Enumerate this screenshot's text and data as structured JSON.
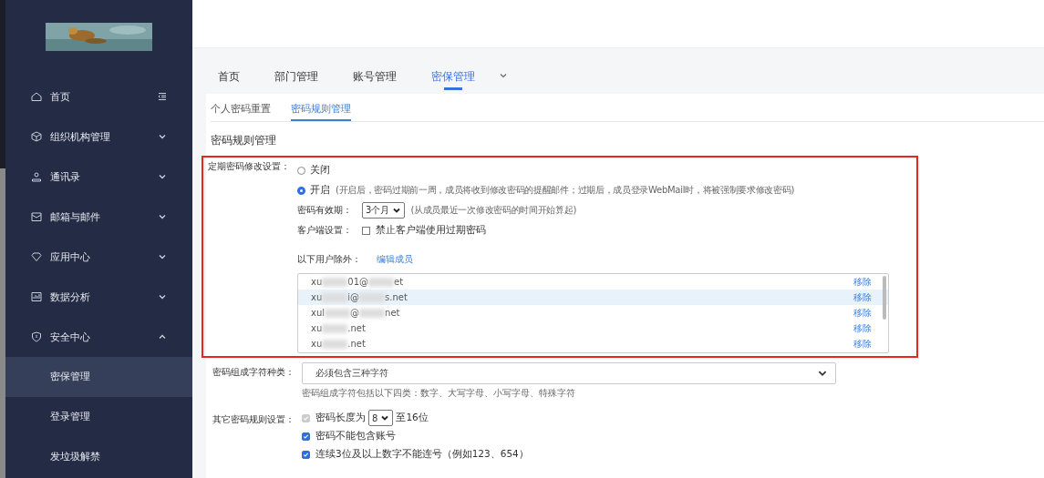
{
  "sidebar": {
    "items": [
      {
        "label": "首页"
      },
      {
        "label": "组织机构管理",
        "expanded": false
      },
      {
        "label": "通讯录",
        "expanded": false
      },
      {
        "label": "邮箱与邮件",
        "expanded": false
      },
      {
        "label": "应用中心",
        "expanded": false
      },
      {
        "label": "数据分析",
        "expanded": false
      },
      {
        "label": "安全中心",
        "expanded": true,
        "children": [
          {
            "label": "密保管理",
            "selected": true
          },
          {
            "label": "登录管理",
            "selected": false
          },
          {
            "label": "发垃圾解禁",
            "selected": false
          }
        ]
      }
    ]
  },
  "top_tabs": [
    {
      "label": "首页",
      "selected": false
    },
    {
      "label": "部门管理",
      "selected": false
    },
    {
      "label": "账号管理",
      "selected": false
    },
    {
      "label": "密保管理",
      "selected": true
    }
  ],
  "sub_tabs": [
    {
      "label": "个人密码重置",
      "selected": false
    },
    {
      "label": "密码规则管理",
      "selected": true
    }
  ],
  "section_title": "密码规则管理",
  "expiry": {
    "label": "定期密码修改设置：",
    "options": [
      {
        "label": "关闭",
        "selected": false
      },
      {
        "label": "开启",
        "note": "(开启后，密码过期前一周，成员将收到修改密码的提醒邮件；过期后，成员登录WebMail时，将被强制要求修改密码)",
        "selected": true
      }
    ],
    "validity_label": "密码有效期：",
    "validity_value": "3个月",
    "validity_note": "(从成员最近一次修改密码的时间开始算起)",
    "client_label": "客户端设置：",
    "client_option": {
      "label": "禁止客户端使用过期密码",
      "checked": false
    },
    "except_label": "以下用户除外：",
    "edit_link": "编辑成员",
    "members": [
      {
        "parts": [
          "xu",
          "01@",
          "et"
        ],
        "selected": false,
        "action": "移除"
      },
      {
        "parts": [
          "xu",
          "i@",
          "s.net"
        ],
        "selected": true,
        "action": "移除"
      },
      {
        "parts": [
          "xul",
          "@",
          "net"
        ],
        "selected": false,
        "action": "移除"
      },
      {
        "parts": [
          "xu",
          ".net"
        ],
        "selected": false,
        "action": "移除"
      },
      {
        "parts": [
          "xu",
          ".net"
        ],
        "selected": false,
        "action": "移除"
      }
    ]
  },
  "composition": {
    "label": "密码组成字符种类：",
    "value": "必须包含三种字符",
    "hint": "密码组成字符包括以下四类：数字、大写字母、小写字母、特殊字符"
  },
  "other_rules": {
    "label": "其它密码规则设置：",
    "rules": [
      {
        "kind": "length",
        "checked": true,
        "disabled": true,
        "before": "密码长度为",
        "value": "8",
        "after": "至16位"
      },
      {
        "kind": "plain",
        "checked": true,
        "disabled": false,
        "label": "密码不能包含账号"
      },
      {
        "kind": "plain",
        "checked": true,
        "disabled": false,
        "label": "连续3位及以上数字不能连号（例如123、654）"
      }
    ]
  }
}
